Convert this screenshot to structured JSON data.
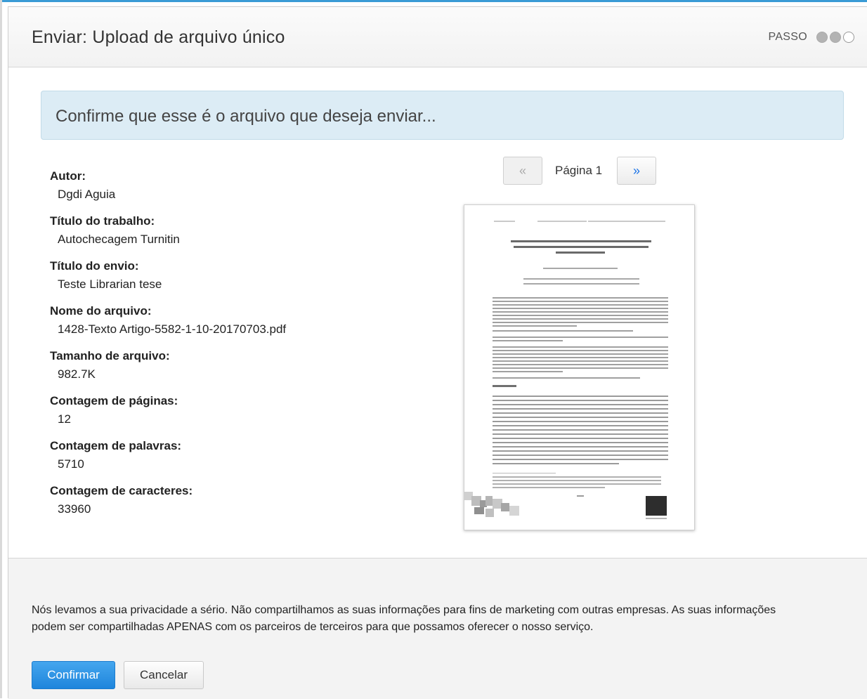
{
  "header": {
    "title": "Enviar: Upload de arquivo único",
    "step_label": "PASSO",
    "steps": [
      "filled",
      "filled",
      "empty"
    ]
  },
  "banner": {
    "text": "Confirme que esse é o arquivo que deseja enviar..."
  },
  "fields": [
    {
      "label": "Autor:",
      "value": "Dgdi Aguia"
    },
    {
      "label": "Título do trabalho:",
      "value": "Autochecagem Turnitin"
    },
    {
      "label": "Título do envio:",
      "value": "Teste Librarian tese"
    },
    {
      "label": "Nome do arquivo:",
      "value": "1428-Texto Artigo-5582-1-10-20170703.pdf"
    },
    {
      "label": "Tamanho de arquivo:",
      "value": "982.7K"
    },
    {
      "label": "Contagem de páginas:",
      "value": "12"
    },
    {
      "label": "Contagem de palavras:",
      "value": "5710"
    },
    {
      "label": "Contagem de caracteres:",
      "value": "33960"
    }
  ],
  "pager": {
    "prev": "«",
    "label": "Página 1",
    "next": "»"
  },
  "preview": {
    "doc_title": "Identificando o Estado da Arte e Proposição de Indicadores em Competência em Informação (CoInfo) no Brasil sob o Foco da Análise Qualitativa",
    "section_heading": "1 Introdução",
    "page_number": "145"
  },
  "footer": {
    "privacy_text": "Nós levamos a sua privacidade a sério. Não compartilhamos as suas informações para fins de marketing com outras empresas. As suas informações podem ser compartilhadas APENAS com os parceiros de terceiros para que possamos oferecer o nosso serviço.",
    "confirm_label": "Confirmar",
    "cancel_label": "Cancelar"
  },
  "colors": {
    "accent": "#1e85dc",
    "banner_bg": "#dcecf5",
    "footer_bg": "#f3f3f3"
  }
}
